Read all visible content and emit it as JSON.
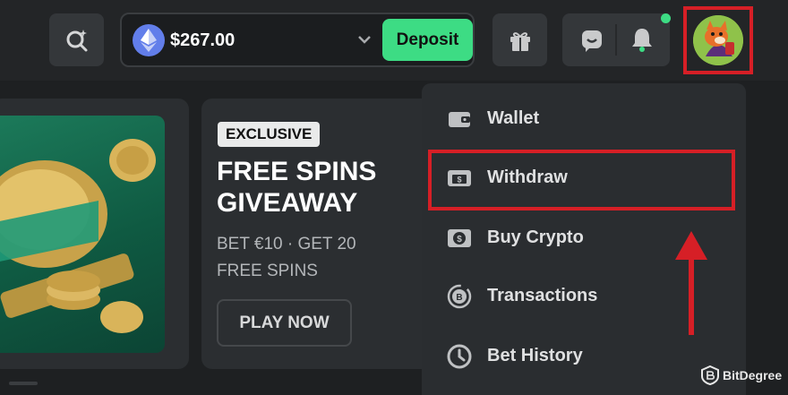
{
  "header": {
    "wallet": {
      "balance": "$267.00",
      "currency_icon": "ethereum-icon"
    },
    "deposit_label": "Deposit",
    "icons": [
      "search-icon",
      "gift-icon",
      "chat-icon",
      "bell-icon"
    ]
  },
  "promo": {
    "badge": "EXCLUSIVE",
    "title_line1": "FREE SPINS",
    "title_line2": "GIVEAWAY",
    "sub_line1": "BET €10 · GET 20",
    "sub_line2": "FREE SPINS",
    "cta": "PLAY NOW"
  },
  "menu": {
    "items": [
      {
        "label": "Wallet",
        "icon": "wallet-icon"
      },
      {
        "label": "Withdraw",
        "icon": "cash-icon"
      },
      {
        "label": "Buy Crypto",
        "icon": "buy-crypto-icon"
      },
      {
        "label": "Transactions",
        "icon": "transactions-icon"
      },
      {
        "label": "Bet History",
        "icon": "clock-icon"
      }
    ]
  },
  "watermark": {
    "text": "BitDegree"
  },
  "colors": {
    "accent_green": "#3ddc84",
    "highlight_red": "#d61f26",
    "eth_blue": "#627eea"
  }
}
